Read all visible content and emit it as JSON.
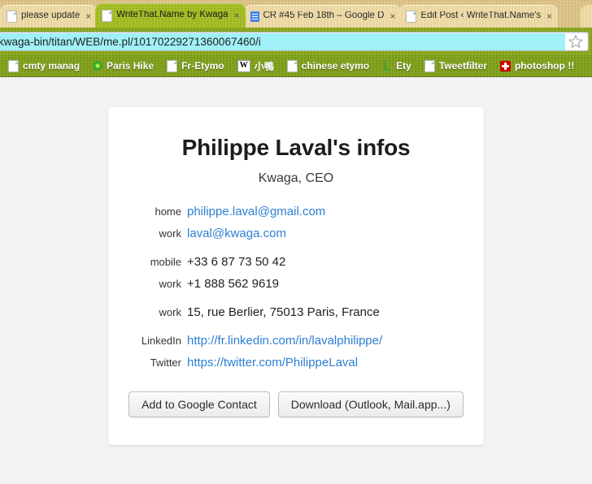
{
  "browser": {
    "tabs": [
      {
        "title": "please update",
        "favicon": "page-icon",
        "active": false,
        "close_label": "×"
      },
      {
        "title": "WriteThat.Name by Kwaga",
        "favicon": "page-icon",
        "active": true,
        "close_label": "×"
      },
      {
        "title": "CR #45 Feb 18th – Google D",
        "favicon": "google-docs-icon",
        "active": false,
        "close_label": "×"
      },
      {
        "title": "Edit Post ‹ WriteThat.Name's",
        "favicon": "page-icon",
        "active": false,
        "close_label": "×"
      }
    ],
    "address_bar": {
      "url": "kwaga-bin/titan/WEB/me.pl/101702292713600674 60/i",
      "url_text": "kwaga-bin/titan/WEB/me.pl/10170229271360067460/i",
      "bookmark_icon": "star-icon",
      "selected": true
    },
    "bookmarks": [
      {
        "label": "cmty manag",
        "icon": "page-icon"
      },
      {
        "label": "Paris Hike",
        "icon": "flower-icon"
      },
      {
        "label": "Fr-Etymo",
        "icon": "page-icon"
      },
      {
        "label": "小鴨",
        "icon": "wikipedia-icon"
      },
      {
        "label": "chinese etymo",
        "icon": "page-icon"
      },
      {
        "label": "Ety",
        "icon": "green-bracket-icon"
      },
      {
        "label": "Tweetfilter",
        "icon": "page-icon"
      },
      {
        "label": "photoshop !!",
        "icon": "photoshop-cross-icon"
      }
    ]
  },
  "card": {
    "title": "Philippe Laval's infos",
    "subtitle": "Kwaga, CEO",
    "groups": [
      {
        "rows": [
          {
            "label": "home",
            "value": "philippe.laval@gmail.com",
            "is_link": true
          },
          {
            "label": "work",
            "value": "laval@kwaga.com",
            "is_link": true
          }
        ]
      },
      {
        "rows": [
          {
            "label": "mobile",
            "value": "+33 6 87 73 50 42",
            "is_link": false
          },
          {
            "label": "work",
            "value": "+1 888 562 9619",
            "is_link": false
          }
        ]
      },
      {
        "rows": [
          {
            "label": "work",
            "value": "15, rue Berlier, 75013 Paris, France",
            "is_link": false
          }
        ]
      },
      {
        "rows": [
          {
            "label": "LinkedIn",
            "value": "http://fr.linkedin.com/in/lavalphilippe/",
            "is_link": true
          },
          {
            "label": "Twitter",
            "value": "https://twitter.com/PhilippeLaval",
            "is_link": true
          }
        ]
      }
    ],
    "buttons": [
      {
        "label": "Add to Google Contact",
        "name": "add-to-google-contact-button"
      },
      {
        "label": "Download (Outlook, Mail.app...)",
        "name": "download-button"
      }
    ]
  },
  "colors": {
    "link": "#2d7fd3",
    "page_background": "#f2f2f2",
    "card_background": "#ffffff",
    "active_tab": "#a8c420",
    "inactive_tab": "#e9d59f",
    "toolbar": "#85a518",
    "url_selection": "#9ff1f7"
  }
}
